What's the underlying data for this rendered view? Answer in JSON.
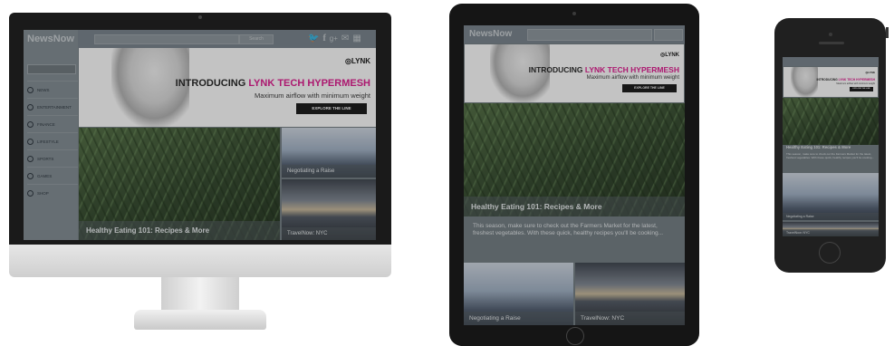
{
  "app": {
    "logo": "NewsNow",
    "search_button": "Search"
  },
  "sidebar": {
    "items": [
      {
        "label": "NEWS"
      },
      {
        "label": "ENTERTAINMENT"
      },
      {
        "label": "FINANCE"
      },
      {
        "label": "LIFESTYLE"
      },
      {
        "label": "SPORTS"
      },
      {
        "label": "GAMES"
      },
      {
        "label": "SHOP"
      }
    ]
  },
  "ad": {
    "brand": "◎LYNK",
    "title_prefix": "INTRODUCING ",
    "title_highlight": "LYNK TECH HYPERMESH",
    "subtitle": "Maximum airflow with minimum weight",
    "button": "EXPLORE THE LINE"
  },
  "articles": {
    "featured_title": "Healthy Eating 101: Recipes & More",
    "featured_summary": "This season, make sure to check out the Farmers Market for the latest, freshest vegetables. With these quick, healthy recipes you'll be cooking...",
    "card1_title": "Negotiating a Raise",
    "card2_title": "TravelNow: NYC"
  },
  "icons": [
    "twitter-icon",
    "facebook-icon",
    "googleplus-icon",
    "mail-icon",
    "grid-icon"
  ],
  "colors": {
    "accent": "#e0148c",
    "device_frame": "#1a1a1a",
    "screen_overlay": "#6f7a80"
  }
}
